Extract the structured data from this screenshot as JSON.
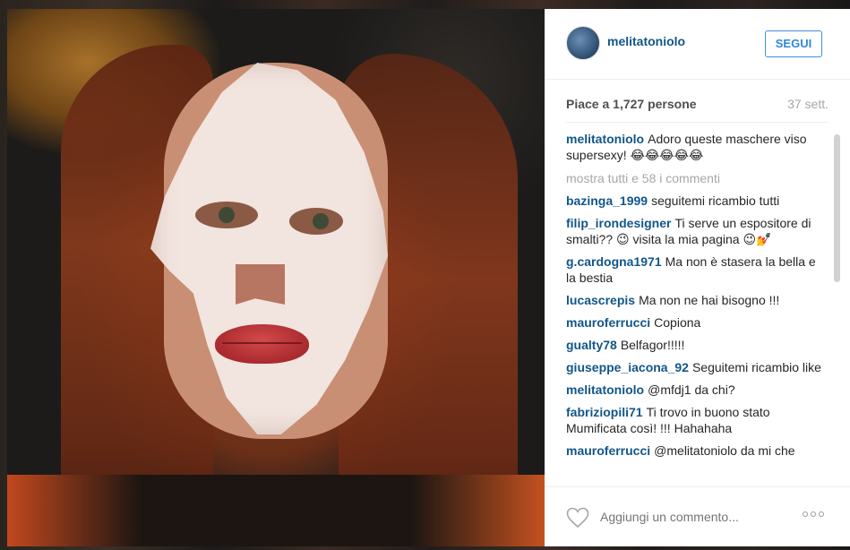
{
  "post": {
    "username": "melitatoniolo",
    "follow_label": "SEGUI",
    "likes": "Piace a 1,727 persone",
    "time": "37 sett."
  },
  "caption": {
    "user": "melitatoniolo",
    "text": "Adoro queste maschere viso supersexy!",
    "emoji": "😂😂😂😂😂"
  },
  "show_all": "mostra tutti e 58 i commenti",
  "comments": [
    {
      "user": "bazinga_1999",
      "text": "seguitemi ricambio tutti"
    },
    {
      "user": "filip_irondesigner",
      "text": "Ti serve un espositore di smalti?? 😉 visita la mia pagina 😉💅"
    },
    {
      "user": "g.cardogna1971",
      "text": "Ma non è stasera la bella e la bestia"
    },
    {
      "user": "lucascrepis",
      "text": "Ma non ne hai bisogno !!!"
    },
    {
      "user": "mauroferrucci",
      "text": "Copiona"
    },
    {
      "user": "gualty78",
      "text": "Belfagor!!!!!"
    },
    {
      "user": "giuseppe_iacona_92",
      "text": "Seguitemi ricambio like"
    },
    {
      "user": "melitatoniolo",
      "text": "@mfdj1 da chi?"
    },
    {
      "user": "fabriziopili71",
      "text": "Ti trovo in buono stato Mumificata così! !!! Hahahaha"
    },
    {
      "user": "mauroferrucci",
      "text": "@melitatoniolo da mi che"
    }
  ],
  "footer": {
    "comment_placeholder": "Aggiungi un commento...",
    "like_icon": "heart-outline-icon",
    "more_icon": "more-options-icon"
  },
  "colors": {
    "username_blue": "#125688",
    "follow_blue": "#2d89d6",
    "muted_gray": "#a5a7aa"
  }
}
